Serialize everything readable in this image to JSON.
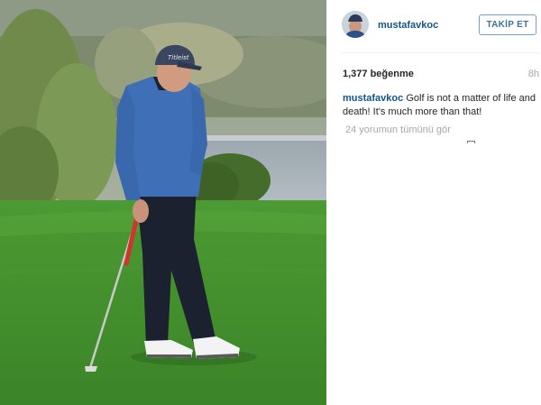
{
  "post": {
    "username": "mustafavkoc",
    "follow_label": "TAKİP ET",
    "likes": "1,377 beğenme",
    "time": "8h",
    "caption_author": "mustafavkoc",
    "caption_text": " Golf is not a matter of life and death! It's much more than that!",
    "comments_link": "24 yorumun tümünü gör"
  },
  "photo": {
    "subject": "golfer-on-green",
    "colors": {
      "grass": "#3f8a2c",
      "sweater": "#3f6fb6",
      "trousers": "#1b1f2b",
      "cap": "#3a4660",
      "shoes": "#f2f2f2",
      "water": "#a8b3c0"
    }
  },
  "colors": {
    "link": "#125688",
    "follow_border": "#70a4d0",
    "muted": "#a5a7aa"
  }
}
